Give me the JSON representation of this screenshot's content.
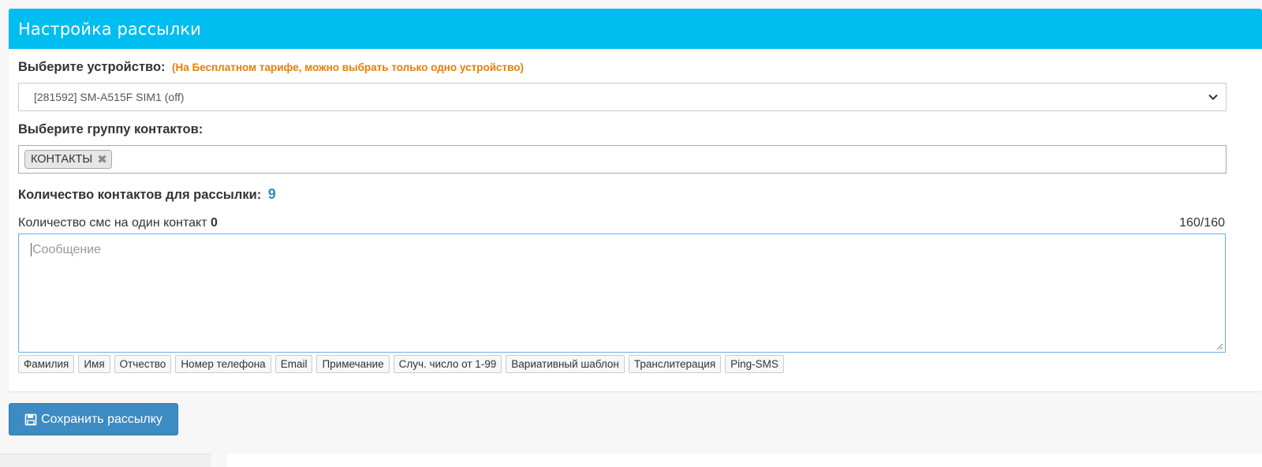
{
  "header": {
    "title": "Настройка рассылки"
  },
  "device": {
    "label": "Выберите устройство:",
    "note": "(На Бесплатном тарифе, можно выбрать только одно устройство)",
    "selected": "[281592] SM-A515F SIM1 (off)"
  },
  "group": {
    "label": "Выберите группу контактов:",
    "tags": [
      "КОНТАКТЫ"
    ],
    "tag_remove": "✖"
  },
  "contacts_count": {
    "label": "Количество контактов для рассылки:",
    "value": "9"
  },
  "sms": {
    "label": "Количество смс на один контакт",
    "value": "0",
    "counter": "160/160",
    "placeholder": "Сообщение"
  },
  "inserts": [
    "Фамилия",
    "Имя",
    "Отчество",
    "Номер телефона",
    "Email",
    "Примечание",
    "Случ. число от 1-99",
    "Вариативный шаблон",
    "Транслитерация",
    "Ping-SMS"
  ],
  "save_button": {
    "label": "Сохранить рассылку",
    "icon": "floppy-disk-icon"
  },
  "colors": {
    "header": "#00bdef",
    "note": "#e87e04",
    "count": "#2f8cc3",
    "button": "#3d8bc3"
  }
}
